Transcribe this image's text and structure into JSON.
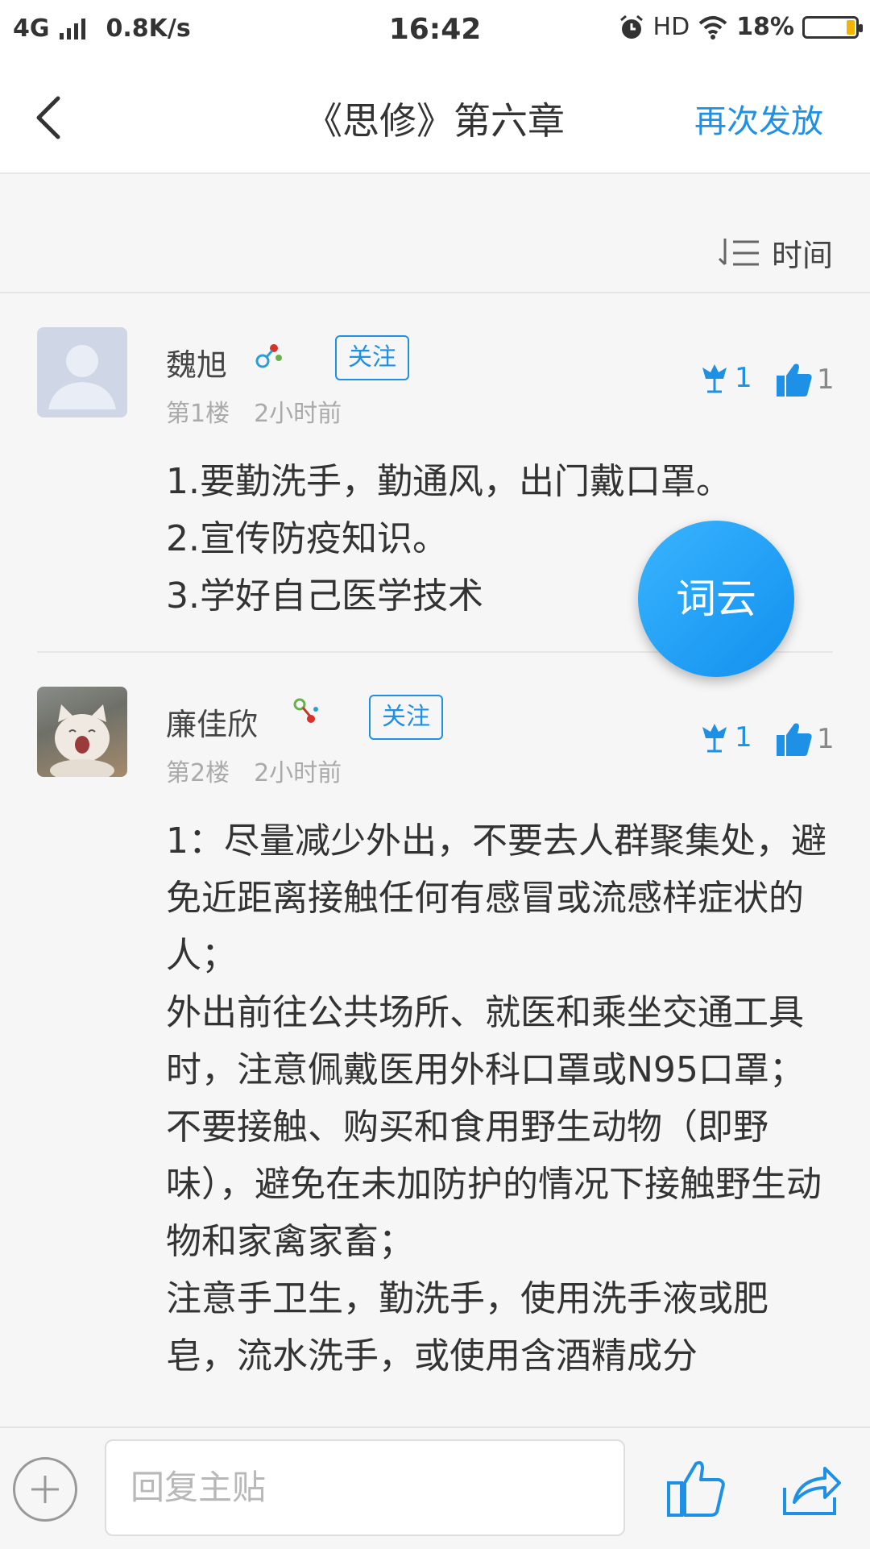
{
  "status_bar": {
    "network": "4G",
    "speed": "0.8K/s",
    "time": "16:42",
    "hd": "HD",
    "battery_percent": "18%",
    "battery_level": 0.18
  },
  "header": {
    "title": "《思修》第六章",
    "action_label": "再次发放"
  },
  "sort": {
    "label": "时间"
  },
  "posts": [
    {
      "user": "魏旭",
      "follow_label": "关注",
      "floor": "第1楼",
      "time": "2小时前",
      "flower_count": "1",
      "like_count": "1",
      "content": "1.要勤洗手，勤通风，出门戴口罩。\n2.宣传防疫知识。\n3.学好自己医学技术"
    },
    {
      "user": "廉佳欣",
      "follow_label": "关注",
      "floor": "第2楼",
      "time": "2小时前",
      "flower_count": "1",
      "like_count": "1",
      "content": "1：尽量减少外出，不要去人群聚集处，避免近距离接触任何有感冒或流感样症状的人；\n外出前往公共场所、就医和乘坐交通工具时，注意佩戴医用外科口罩或N95口罩；\n不要接触、购买和食用野生动物（即野味），避免在未加防护的情况下接触野生动物和家禽家畜；\n注意手卫生，勤洗手，使用洗手液或肥皂，流水洗手，或使用含酒精成分"
    }
  ],
  "word_cloud_label": "词云",
  "reply": {
    "placeholder": "回复主贴"
  },
  "colors": {
    "accent": "#1e90e6"
  }
}
